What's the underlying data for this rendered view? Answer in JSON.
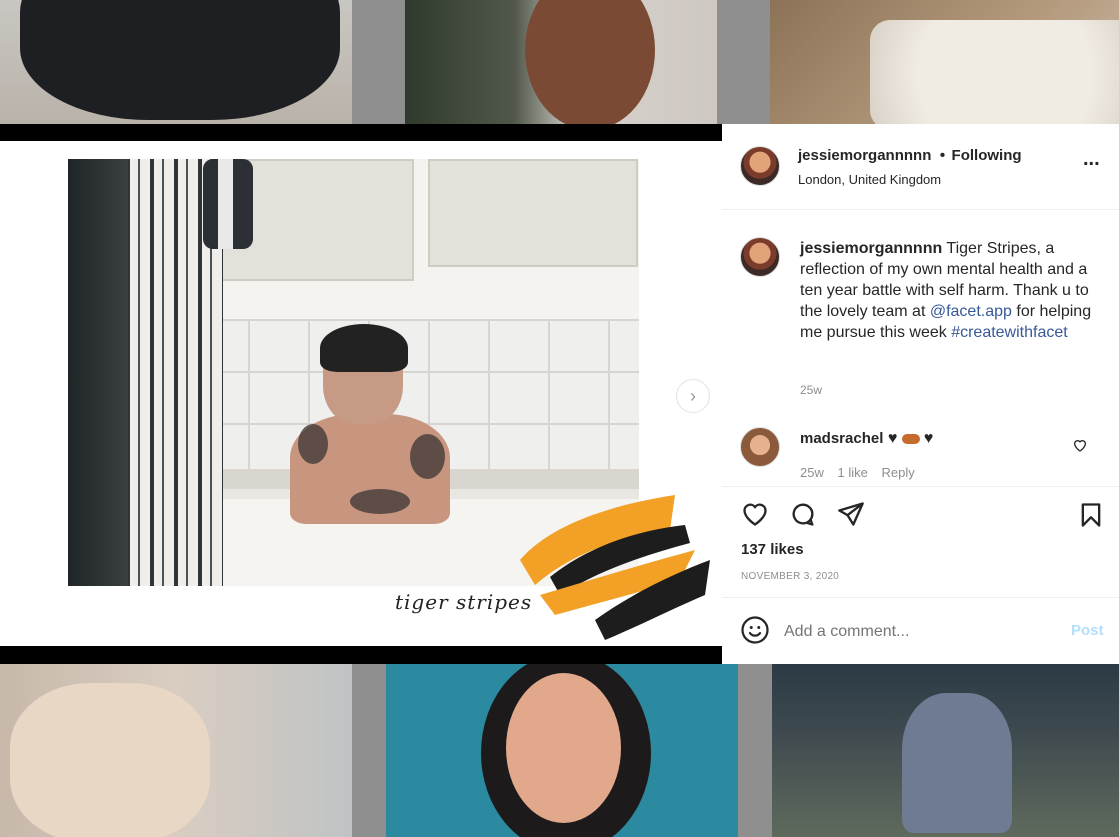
{
  "header": {
    "username": "jessiemorgannnnn",
    "separator": "•",
    "follow_status": "Following",
    "location": "London, United Kingdom",
    "more_label": "..."
  },
  "caption": {
    "username": "jessiemorgannnnn",
    "text_1": " Tiger Stripes, a reflection of my own mental health and a ten year battle with self harm. Thank u to the lovely team at ",
    "mention": "@facet.app",
    "text_2": " for helping me pursue this week ",
    "hashtag": "#createwithfacet",
    "age": "25w"
  },
  "comment": {
    "username": "madsrachel",
    "text": " ♥ ",
    "age": "25w",
    "likes": "1 like",
    "reply_label": "Reply"
  },
  "actions": {
    "likes_count": "137 likes",
    "date": "NOVEMBER 3, 2020"
  },
  "add_comment": {
    "placeholder": "Add a comment...",
    "post_label": "Post"
  },
  "photo": {
    "handwritten_caption": "tiger stripes"
  },
  "colors": {
    "link": "#385898",
    "post_button": "#b2dffc",
    "accent_orange": "#f2a126"
  }
}
